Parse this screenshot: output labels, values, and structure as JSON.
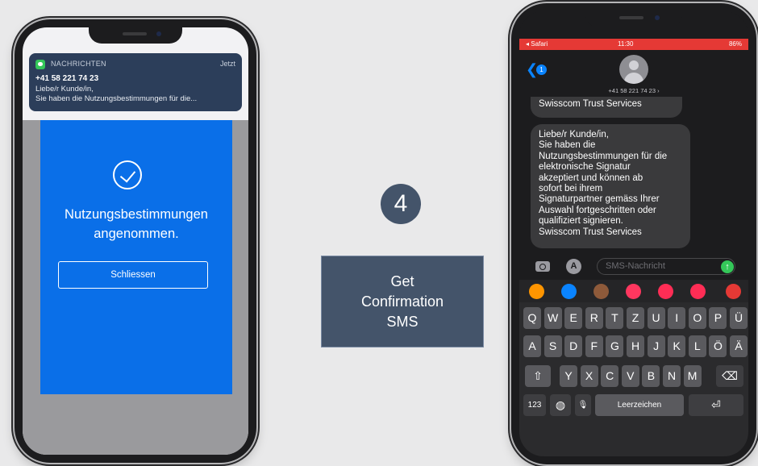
{
  "left_phone": {
    "notification": {
      "app_name": "NACHRICHTEN",
      "time": "Jetzt",
      "sender": "+41 58 221 74 23",
      "line1": "Liebe/r Kunde/in,",
      "line2": "Sie haben die Nutzungsbestimmungen für die..."
    },
    "message_line1": "Nutzungsbestimmungen",
    "message_line2": "angenommen.",
    "close_button": "Schliessen"
  },
  "step": {
    "number": "4",
    "line1": "Get",
    "line2": "Confirmation",
    "line3": "SMS"
  },
  "right_phone": {
    "status": {
      "left": "◂ Safari",
      "time": "11:30",
      "battery": "86%"
    },
    "back_count": "1",
    "contact": "+41 58 221 74 23 ›",
    "bubble1": "Swisscom Trust Services",
    "bubble2_lines": [
      "Liebe/r Kunde/in,",
      "Sie haben die",
      "Nutzungsbestimmungen für die",
      "elektronische Signatur",
      "akzeptiert und können ab",
      "sofort bei ihrem",
      "Signaturpartner gemäss Ihrer",
      "Auswahl fortgeschritten oder",
      "qualifiziert signieren.",
      "Swisscom Trust Services"
    ],
    "input_placeholder": "SMS-Nachricht",
    "keyboard": {
      "row1": [
        "Q",
        "W",
        "E",
        "R",
        "T",
        "Z",
        "U",
        "I",
        "O",
        "P",
        "Ü"
      ],
      "row2": [
        "A",
        "S",
        "D",
        "F",
        "G",
        "H",
        "J",
        "K",
        "L",
        "Ö",
        "Ä"
      ],
      "row3": [
        "Y",
        "X",
        "C",
        "V",
        "B",
        "N",
        "M"
      ],
      "numbers": "123",
      "space": "Leerzeichen"
    },
    "app_colors": [
      "#ff9500",
      "#0a84ff",
      "#8e5a3a",
      "#ff375f",
      "#ff2d55",
      "#ff2d55",
      "#e53935"
    ]
  }
}
